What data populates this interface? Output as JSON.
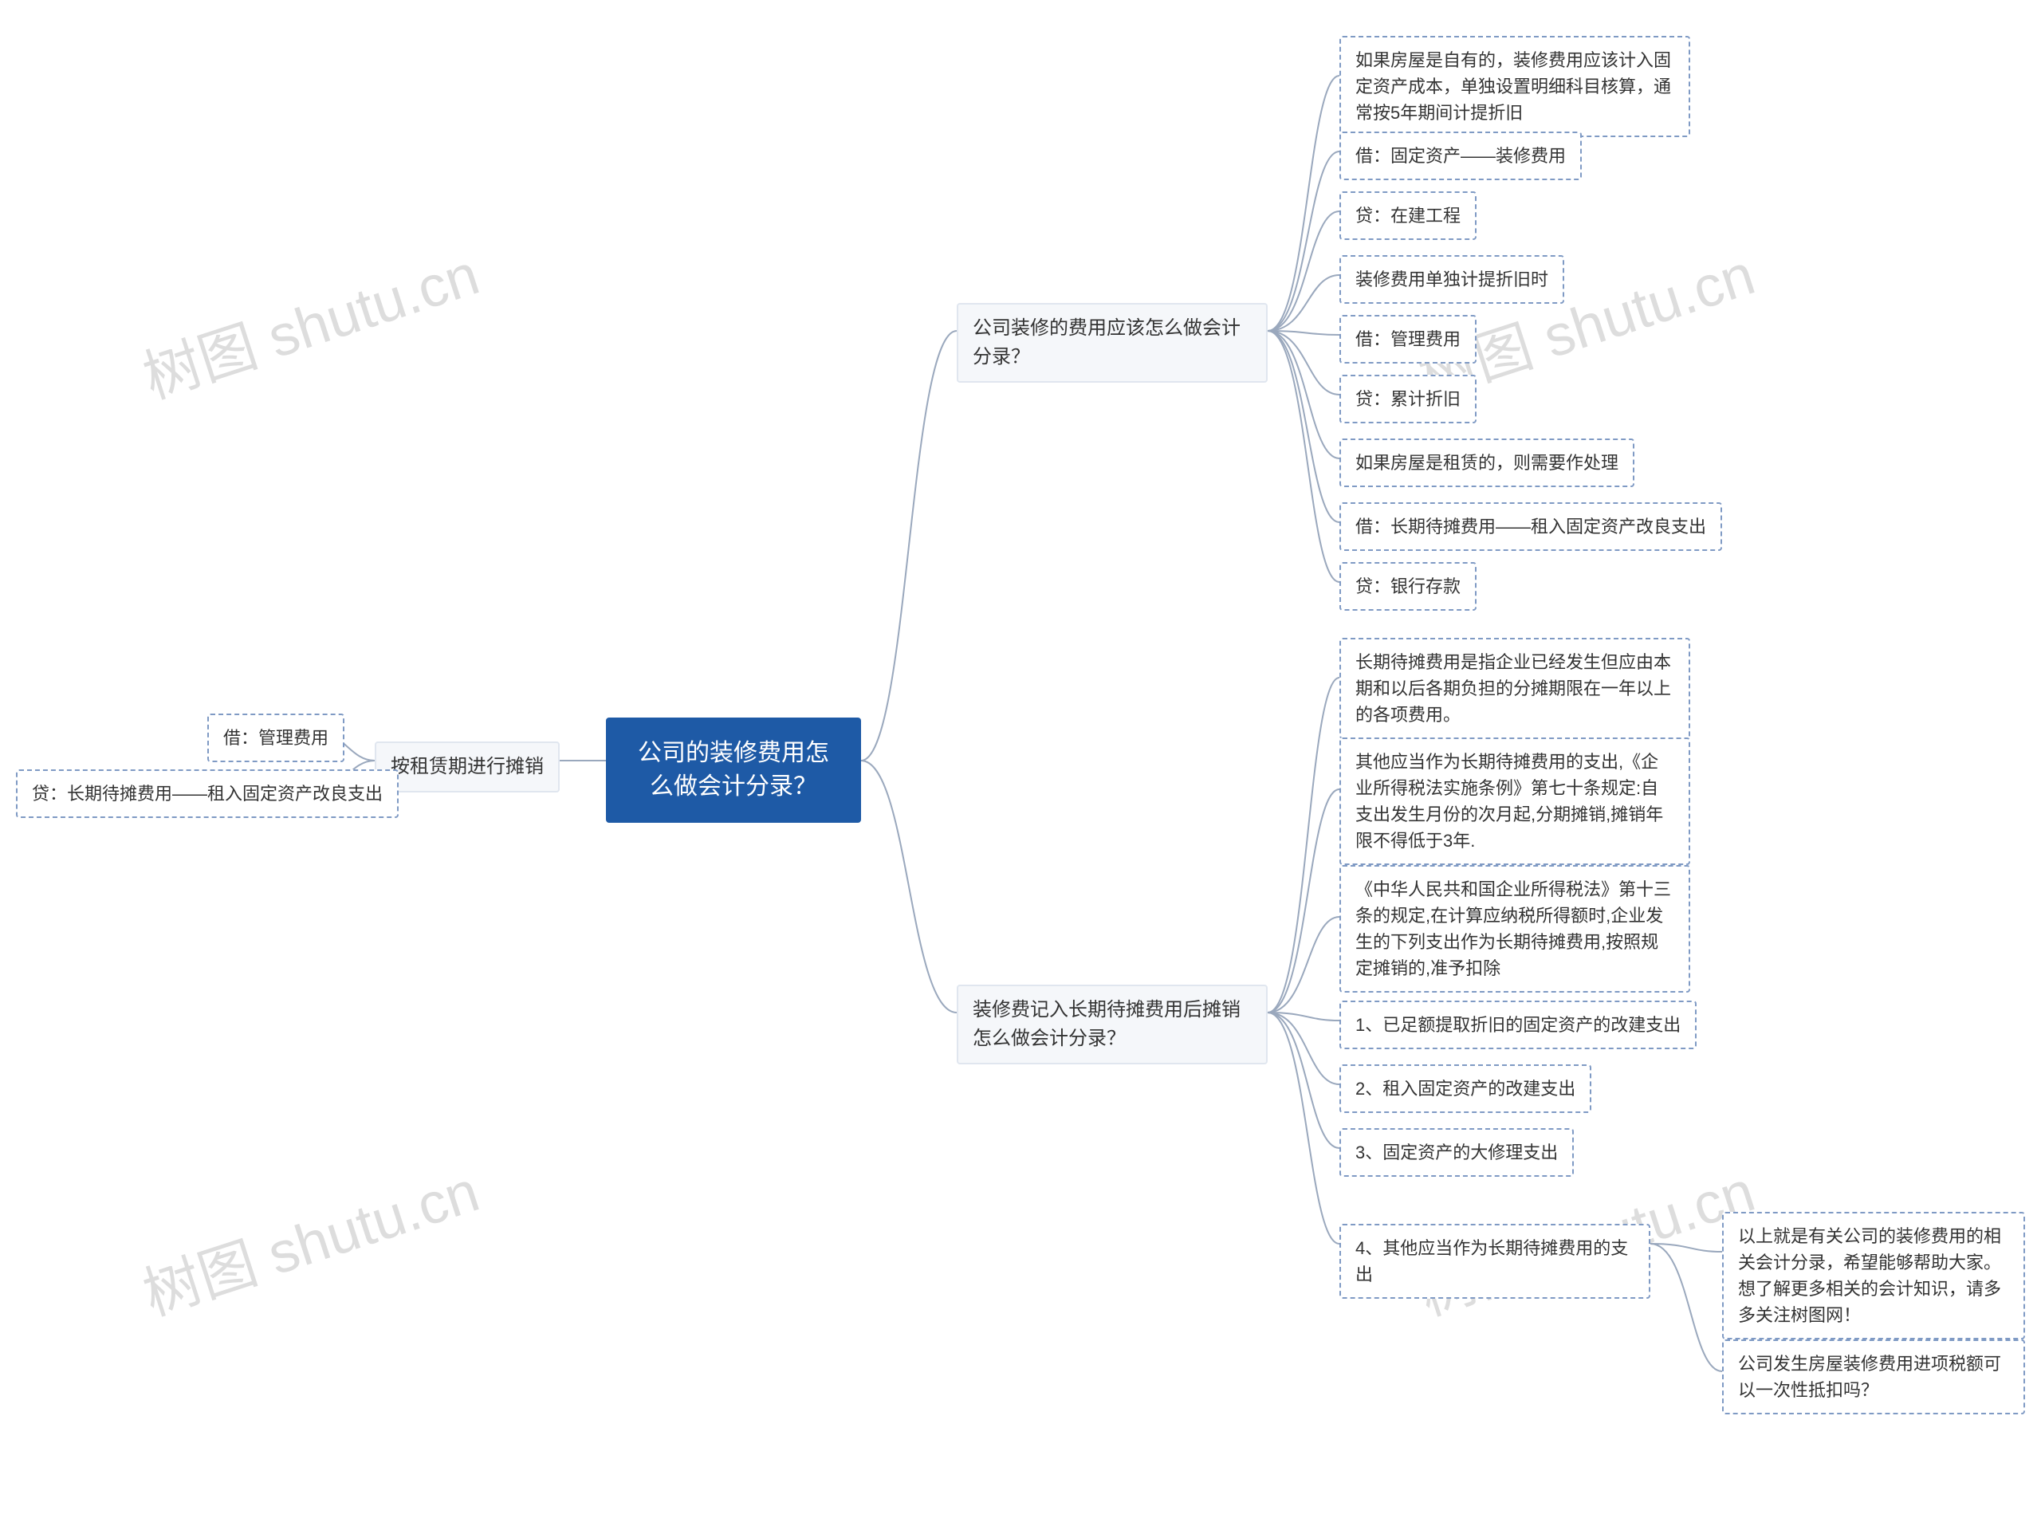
{
  "root": {
    "title": "公司的装修费用怎么做会计分录？"
  },
  "left": {
    "branch": {
      "label": "按租赁期进行摊销",
      "children": {
        "debit": "借：管理费用",
        "credit": "贷：长期待摊费用——租入固定资产改良支出"
      }
    }
  },
  "right": {
    "branch1": {
      "label": "公司装修的费用应该怎么做会计分录？",
      "children": {
        "c1": "如果房屋是自有的，装修费用应该计入固定资产成本，单独设置明细科目核算，通常按5年期间计提折旧",
        "c2": "借：固定资产——装修费用",
        "c3": "贷：在建工程",
        "c4": "装修费用单独计提折旧时",
        "c5": "借：管理费用",
        "c6": "贷：累计折旧",
        "c7": "如果房屋是租赁的，则需要作处理",
        "c8": "借：长期待摊费用——租入固定资产改良支出",
        "c9": "贷：银行存款"
      }
    },
    "branch2": {
      "label": "装修费记入长期待摊费用后摊销怎么做会计分录？",
      "children": {
        "c1": "长期待摊费用是指企业已经发生但应由本期和以后各期负担的分摊期限在一年以上的各项费用。",
        "c2": "其他应当作为长期待摊费用的支出,《企业所得税法实施条例》第七十条规定:自支出发生月份的次月起,分期摊销,摊销年限不得低于3年.",
        "c3": "《中华人民共和国企业所得税法》第十三条的规定,在计算应纳税所得额时,企业发生的下列支出作为长期待摊费用,按照规定摊销的,准予扣除",
        "c4": "1、已足额提取折旧的固定资产的改建支出",
        "c5": "2、租入固定资产的改建支出",
        "c6": "3、固定资产的大修理支出",
        "c7": {
          "label": "4、其他应当作为长期待摊费用的支出",
          "children": {
            "g1": "以上就是有关公司的装修费用的相关会计分录，希望能够帮助大家。想了解更多相关的会计知识，请多多关注树图网！",
            "g2": "公司发生房屋装修费用进项税额可以一次性抵扣吗？"
          }
        }
      }
    }
  },
  "watermarks": {
    "w1": "树图 shutu.cn",
    "w2": "树图 shutu.cn",
    "w3": "树图 shutu.cn",
    "w4": "树图 shutu.cn"
  }
}
